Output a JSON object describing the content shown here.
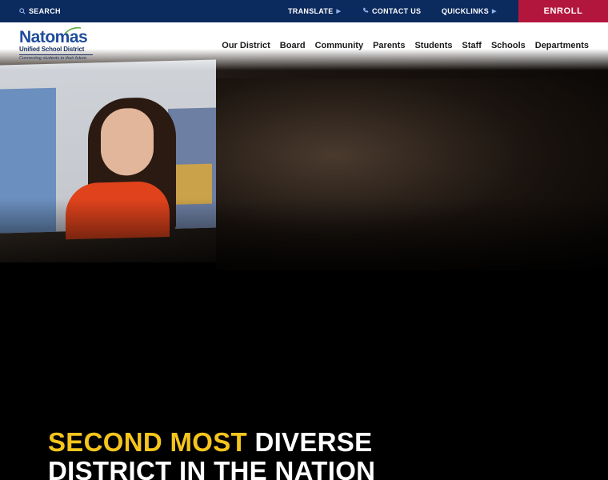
{
  "topbar": {
    "search_label": "SEARCH",
    "translate_label": "TRANSLATE",
    "contact_label": "CONTACT US",
    "quicklinks_label": "QUICKLINKS",
    "enroll_label": "ENROLL"
  },
  "logo": {
    "name": "Natomas",
    "subtitle": "Unified School District",
    "tagline": "Connecting students to their future"
  },
  "nav": {
    "items": [
      "Our District",
      "Board",
      "Community",
      "Parents",
      "Students",
      "Staff",
      "Schools",
      "Departments"
    ]
  },
  "hero": {
    "headline_highlight": "SECOND MOST",
    "headline_rest": " DIVERSE",
    "headline_line2": "DISTRICT IN THE NATION"
  },
  "colors": {
    "topbar_bg": "#0b2a5e",
    "enroll_bg": "#b3163c",
    "highlight": "#f5c51c",
    "logo_blue": "#1f4c9c"
  },
  "icons": {
    "search": "search-icon",
    "phone": "phone-icon",
    "caret": "caret-right-icon"
  }
}
